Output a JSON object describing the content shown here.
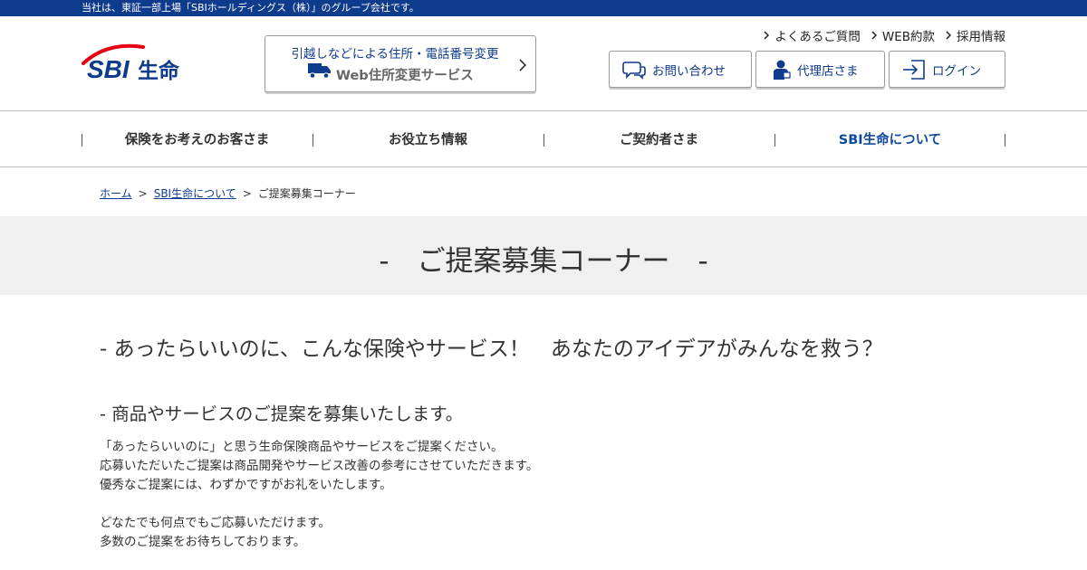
{
  "topbar": {
    "notice": "当社は、東証一部上場「SBIホールディングス（株）」のグループ会社です。"
  },
  "logo": {
    "text_sbi": "SBI",
    "text_name": "生命"
  },
  "move_service": {
    "line1": "引越しなどによる住所・電話番号変更",
    "line2": "Web住所変更サービス"
  },
  "util_links": [
    {
      "label": "よくあるご質問"
    },
    {
      "label": "WEB約款"
    },
    {
      "label": "採用情報"
    }
  ],
  "header_buttons": {
    "contact": "お問い合わせ",
    "agency": "代理店さま",
    "login": "ログイン"
  },
  "global_nav": [
    {
      "label": "保険をお考えのお客さま"
    },
    {
      "label": "お役立ち情報"
    },
    {
      "label": "ご契約者さま"
    },
    {
      "label": "SBI生命について"
    }
  ],
  "breadcrumb": {
    "home": "ホーム",
    "about": "SBI生命について",
    "sep": ">",
    "current": "ご提案募集コーナー"
  },
  "hero": {
    "title": "-　ご提案募集コーナー　-"
  },
  "content": {
    "heading2": "- あったらいいのに、こんな保険やサービス！　あなたのアイデアがみんなを救う？",
    "heading3": "- 商品やサービスのご提案を募集いたします。",
    "paragraphs": [
      "「あったらいいのに」と思う生命保険商品やサービスをご提案ください。",
      "応募いただいたご提案は商品開発やサービス改善の参考にさせていただきます。",
      "優秀なご提案には、わずかですがお礼をいたします。",
      "どなたでも何点でもご応募いただけます。",
      "多数のご提案をお待ちしております。"
    ]
  },
  "colors": {
    "brand_navy": "#0f3b8c",
    "brand_red": "#e60012",
    "hero_bg": "#f0f0f0"
  },
  "icons": [
    "truck-icon",
    "chevron-right-icon",
    "chat-bubble-icon",
    "agent-person-icon",
    "login-arrow-icon"
  ]
}
